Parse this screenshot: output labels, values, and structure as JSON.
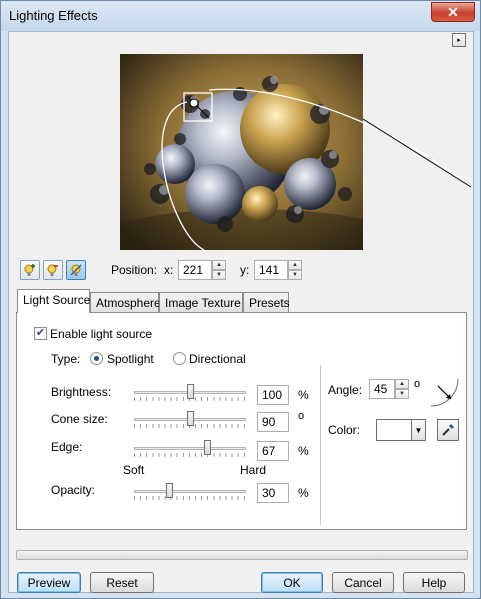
{
  "window": {
    "title": "Lighting Effects",
    "close_glyph": "✕"
  },
  "menu_arrow_glyph": "▸",
  "toolbar": {
    "position_label": "Position:",
    "x_label": "x:",
    "x_value": "221",
    "y_label": "y:",
    "y_value": "141"
  },
  "tabs": [
    {
      "label": "Light Source",
      "selected": true
    },
    {
      "label": "Atmosphere",
      "selected": false
    },
    {
      "label": "Image Texture",
      "selected": false
    },
    {
      "label": "Presets",
      "selected": false
    }
  ],
  "light_source": {
    "enable_label": "Enable light source",
    "enable_checked": true,
    "check_glyph": "✔",
    "type_label": "Type:",
    "spotlight_label": "Spotlight",
    "spotlight_selected": true,
    "directional_label": "Directional",
    "brightness_label": "Brightness:",
    "brightness_value": "100",
    "brightness_unit": "%",
    "brightness_level": 0.5,
    "cone_label": "Cone size:",
    "cone_value": "90",
    "cone_unit": "o",
    "cone_level": 0.5,
    "edge_label": "Edge:",
    "edge_value": "67",
    "edge_unit": "%",
    "edge_level": 0.67,
    "edge_soft_label": "Soft",
    "edge_hard_label": "Hard",
    "opacity_label": "Opacity:",
    "opacity_value": "30",
    "opacity_unit": "%",
    "opacity_level": 0.3,
    "angle_label": "Angle:",
    "angle_value": "45",
    "angle_unit": "o",
    "color_label": "Color:",
    "color_value": "#ffffff"
  },
  "progress": {
    "value": 0
  },
  "buttons": {
    "preview": "Preview",
    "reset": "Reset",
    "ok": "OK",
    "cancel": "Cancel",
    "help": "Help"
  },
  "spin_up_glyph": "▲",
  "spin_down_glyph": "▼",
  "dropdown_glyph": "▼",
  "icons": [
    "add-light-icon",
    "remove-light-icon",
    "toggle-light-icon",
    "eyedropper-icon",
    "angle-dial-icon"
  ]
}
